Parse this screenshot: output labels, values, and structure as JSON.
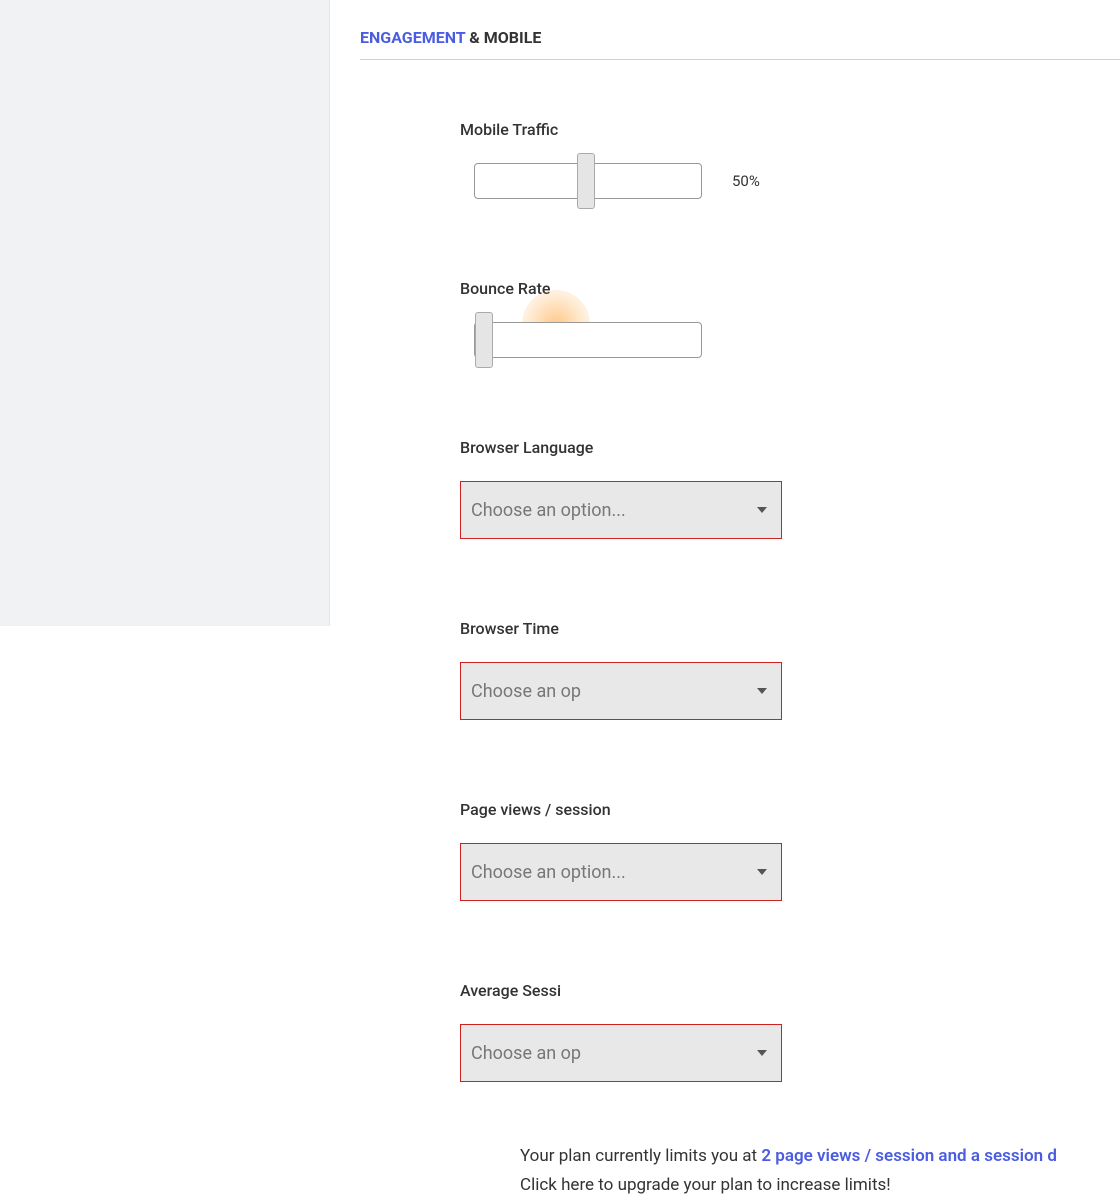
{
  "header": {
    "accent": "ENGAGEMENT",
    "rest": " & MOBILE"
  },
  "fields": {
    "mobile_traffic": {
      "label": "Mobile Traffic",
      "value_text": "50%",
      "handle_left_pct": 45
    },
    "bounce_rate": {
      "label": "Bounce Rate",
      "handle_left_pct": 0
    },
    "browser_language": {
      "label": "Browser Language",
      "placeholder": "Choose an option..."
    },
    "browser_timezone": {
      "label": "Browser Time",
      "placeholder": "Choose an op"
    },
    "page_views": {
      "label": "Page views / session",
      "placeholder": "Choose an option..."
    },
    "avg_session": {
      "label": "Average Sessi",
      "placeholder": "Choose an op"
    }
  },
  "notice": {
    "prefix": "Your plan currently limits you at ",
    "link": "2 page views / session and a session d",
    "line2": "Click here to upgrade your plan to increase limits!"
  }
}
